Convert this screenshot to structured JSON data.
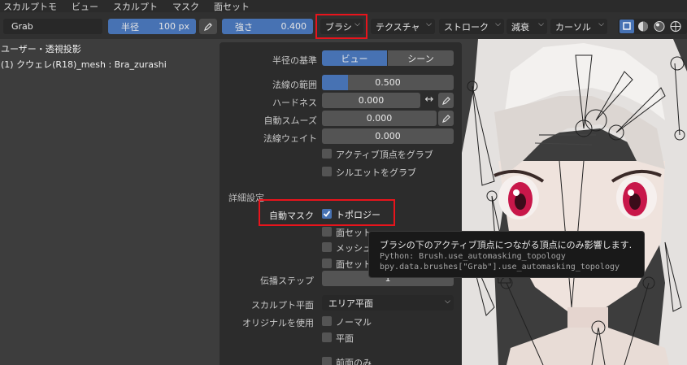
{
  "menubar": [
    "スカルプトモ",
    "ビュー",
    "スカルプト",
    "マスク",
    "面セット"
  ],
  "toolbar": {
    "brush_name": "Grab",
    "radius_label": "半径",
    "radius_value": "100 px",
    "strength_label": "強さ",
    "strength_value": "0.400",
    "brush_menu": "ブラシ",
    "texture_menu": "テクスチャ",
    "stroke_menu": "ストローク",
    "falloff_menu": "減衰",
    "cursor_menu": "カーソル"
  },
  "viewport": {
    "view_name": "ユーザー・透視投影",
    "object_name": "(1) クウェレ(R18)_mesh : Bra_zurashi"
  },
  "panel": {
    "radius_basis_label": "半径の基準",
    "radius_basis_options": [
      "ビュー",
      "シーン"
    ],
    "radius_basis_selected": "ビュー",
    "normal_radius_label": "法線の範囲",
    "normal_radius_value": "0.500",
    "normal_radius_fraction": 0.2,
    "hardness_label": "ハードネス",
    "hardness_value": "0.000",
    "autosmooth_label": "自動スムーズ",
    "autosmooth_value": "0.000",
    "normal_weight_label": "法線ウェイト",
    "normal_weight_value": "0.000",
    "grab_active_vertex": "アクティブ頂点をグラブ",
    "grab_silhouette": "シルエットをグラブ",
    "advanced_header": "詳細設定",
    "automasking_label": "自動マスク",
    "topology_label": "トポロジー",
    "topology_checked": true,
    "face_sets_label": "面セット",
    "mesh_boundary_label": "メッシュ",
    "face_sets_boundary_label": "面セット",
    "propagation_steps_label": "伝播ステップ",
    "propagation_steps_value": "1",
    "sculpt_plane_label": "スカルプト平面",
    "sculpt_plane_value": "エリア平面",
    "use_original_label": "オリジナルを使用",
    "original_normal_label": "ノーマル",
    "original_plane_label": "平面",
    "front_faces_label": "前面のみ"
  },
  "tooltip": {
    "description": "ブラシの下のアクティブ頂点につながる頂点にのみ影響します.",
    "python": "Python: Brush.use_automasking_topology",
    "data_path": "bpy.data.brushes[\"Grab\"].use_automasking_topology"
  },
  "colors": {
    "accent_blue": "#4772b3",
    "highlight_red": "#e8141c",
    "panel_bg": "#2c2c2c",
    "field_bg": "#545454"
  },
  "icons": [
    "pen-pressure-icon",
    "chevron-down-icon",
    "checkmark-icon",
    "double-arrow-icon",
    "viewport-shading-icons"
  ]
}
